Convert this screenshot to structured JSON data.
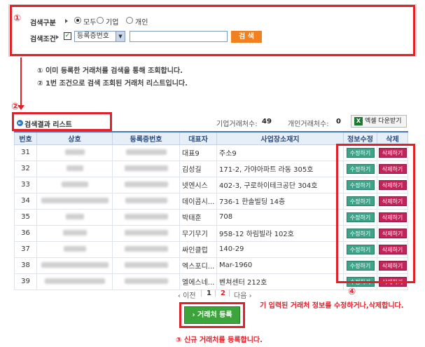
{
  "search": {
    "category_label": "검색구분",
    "radio_options": [
      {
        "label": "모두",
        "selected": true
      },
      {
        "label": "기업",
        "selected": false
      },
      {
        "label": "개인",
        "selected": false
      }
    ],
    "condition_label": "검색조건",
    "condition_checked": true,
    "select_value": "등록증번호",
    "input_value": "",
    "button_label": "검 색"
  },
  "annotations": {
    "marker_1": "①",
    "marker_2": "②",
    "marker_3": "③",
    "marker_4": "④",
    "note_1": "① 이미 등록한 거래처를 검색을 통해 조회합니다.",
    "note_2": "② 1번 조건으로 검색 조회된 거래처 리스트입니다.",
    "note_3": "③ 신규 거래처를 등록합니다.",
    "note_4": "기 입력된 거래처 정보를 수정하거나,삭제합니다."
  },
  "results": {
    "title": "검색결과 리스트",
    "corp_count_label": "기업거래처수:",
    "corp_count": "49",
    "person_count_label": "개인거래처수:",
    "person_count": "0",
    "excel_button": "엑셀 다운받기"
  },
  "table": {
    "headers": [
      "번호",
      "상호",
      "등록증번호",
      "대표자",
      "사업장소재지",
      "정보수정",
      "삭제"
    ],
    "edit_label": "수정하기",
    "delete_label": "삭제하기",
    "rows": [
      {
        "no": "31",
        "rep": "대표9",
        "addr": "주소9"
      },
      {
        "no": "32",
        "rep": "김성길",
        "addr": "171-2, 가야아파트 라동 305호"
      },
      {
        "no": "33",
        "rep": "넷엔시스",
        "addr": "402-3, 구로하이테크공단 304호"
      },
      {
        "no": "34",
        "rep": "데이콤시...",
        "addr": "736-1 한솔빌딩 14층"
      },
      {
        "no": "35",
        "rep": "박태훈",
        "addr": "708"
      },
      {
        "no": "36",
        "rep": "무기무기",
        "addr": "958-12 하림빌라 102호"
      },
      {
        "no": "37",
        "rep": "싸인클럽",
        "addr": "140-29"
      },
      {
        "no": "38",
        "rep": "엑스포디...",
        "addr": "Mar-1960"
      },
      {
        "no": "39",
        "rep": "엘에스네...",
        "addr": "벤쳐센터 212호"
      }
    ]
  },
  "pager": {
    "prev": "‹ 이전",
    "pages": [
      "1",
      "2"
    ],
    "current": "2",
    "next": "다음 ›"
  },
  "register_button": "› 거래처 등록",
  "colors": {
    "annotation_red": "#e2202a",
    "search_orange": "#f08020",
    "register_green": "#3ba43a",
    "edit_green": "#3fa38a",
    "delete_magenta": "#c2245a"
  }
}
